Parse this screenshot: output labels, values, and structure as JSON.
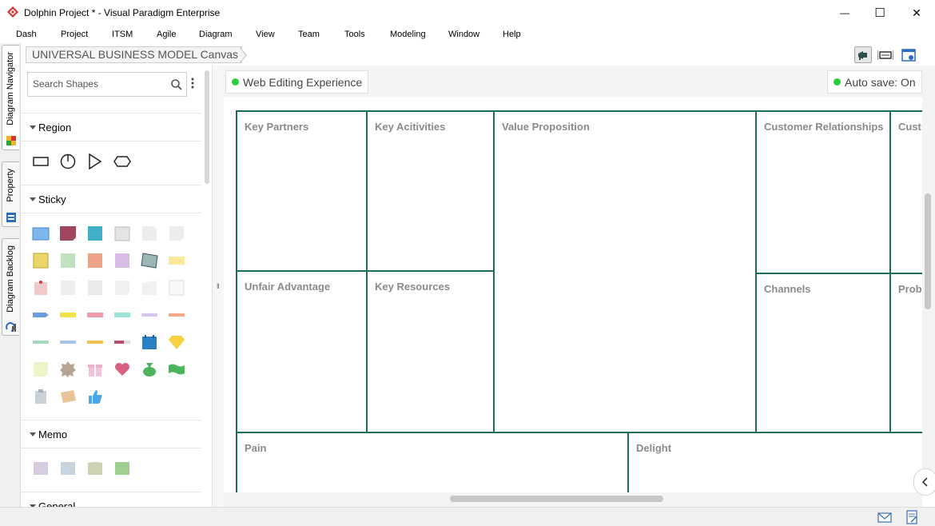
{
  "window": {
    "title": "Dolphin Project * - Visual Paradigm Enterprise",
    "minimize_glyph": "—",
    "maximize_glyph": "☐",
    "close_glyph": "✕"
  },
  "menu": [
    "Dash",
    "Project",
    "ITSM",
    "Agile",
    "Diagram",
    "View",
    "Team",
    "Tools",
    "Modeling",
    "Window",
    "Help"
  ],
  "vtabs": {
    "diagram_navigator": "Diagram Navigator",
    "property": "Property",
    "diagram_backlog": "Diagram Backlog"
  },
  "breadcrumb": "UNIVERSAL BUSINESS MODEL Canvas",
  "shapes_panel": {
    "search_placeholder": "Search Shapes",
    "categories": {
      "region": "Region",
      "sticky": "Sticky",
      "memo": "Memo",
      "general": "General"
    }
  },
  "status": {
    "web_editing": "Web Editing Experience",
    "auto_save": "Auto save: On"
  },
  "canvas": {
    "border_color": "#1d6b5f",
    "cells": {
      "key_partners": "Key Partners",
      "key_activities": "Key Acitivities",
      "value_proposition": "Value Proposition",
      "customer_relationships": "Customer Relationships",
      "customer_segments": "Cust",
      "unfair_advantage": "Unfair Advantage",
      "key_resources": "Key Resources",
      "channels": "Channels",
      "problem": "Prob",
      "pain": "Pain",
      "delight": "Delight"
    }
  },
  "colors": {
    "accent_green": "#2ecc40",
    "app_icon_red": "#d9342b"
  }
}
